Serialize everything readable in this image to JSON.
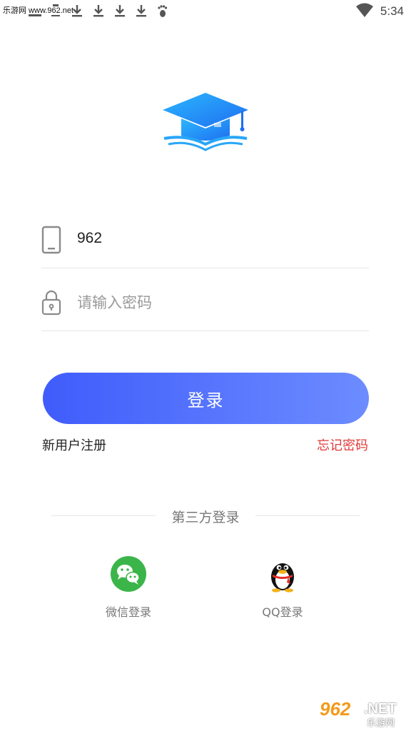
{
  "status_bar": {
    "watermark": "乐游网 www.962.net",
    "time": "5:34"
  },
  "form": {
    "phone_value": "962",
    "password_placeholder": "请输入密码"
  },
  "login_button_label": "登录",
  "links": {
    "register": "新用户注册",
    "forgot_password": "忘记密码"
  },
  "third_party": {
    "title": "第三方登录",
    "wechat_label": "微信登录",
    "qq_label": "QQ登录"
  },
  "watermark_bottom": {
    "brand_number": "962",
    "brand_suffix": ".NET",
    "brand_name": "乐游网"
  },
  "colors": {
    "button_gradient_start": "#3f5cfb",
    "button_gradient_end": "#6c8cff",
    "forgot_link": "#e03b3b",
    "wechat_green": "#3bb54a",
    "logo_blue": "#2a8ff5"
  }
}
